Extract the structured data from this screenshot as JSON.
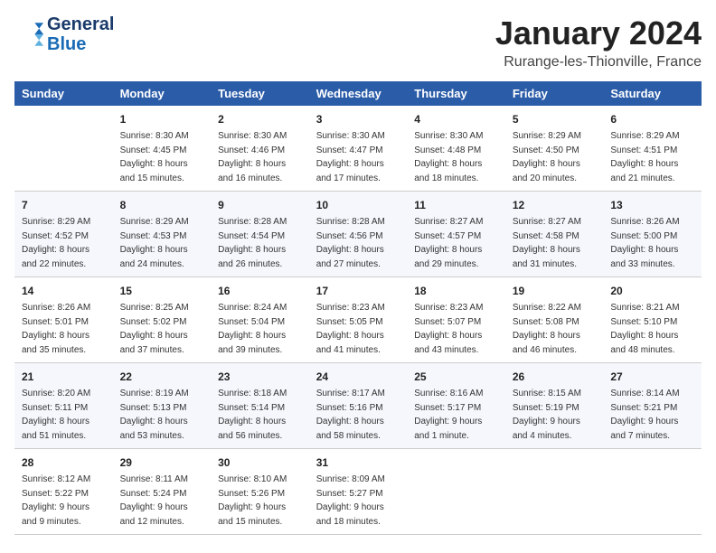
{
  "header": {
    "logo_line1": "General",
    "logo_line2": "Blue",
    "month_title": "January 2024",
    "location": "Rurange-les-Thionville, France"
  },
  "days_of_week": [
    "Sunday",
    "Monday",
    "Tuesday",
    "Wednesday",
    "Thursday",
    "Friday",
    "Saturday"
  ],
  "weeks": [
    [
      {
        "day": "",
        "sunrise": "",
        "sunset": "",
        "daylight": ""
      },
      {
        "day": "1",
        "sunrise": "Sunrise: 8:30 AM",
        "sunset": "Sunset: 4:45 PM",
        "daylight": "Daylight: 8 hours and 15 minutes."
      },
      {
        "day": "2",
        "sunrise": "Sunrise: 8:30 AM",
        "sunset": "Sunset: 4:46 PM",
        "daylight": "Daylight: 8 hours and 16 minutes."
      },
      {
        "day": "3",
        "sunrise": "Sunrise: 8:30 AM",
        "sunset": "Sunset: 4:47 PM",
        "daylight": "Daylight: 8 hours and 17 minutes."
      },
      {
        "day": "4",
        "sunrise": "Sunrise: 8:30 AM",
        "sunset": "Sunset: 4:48 PM",
        "daylight": "Daylight: 8 hours and 18 minutes."
      },
      {
        "day": "5",
        "sunrise": "Sunrise: 8:29 AM",
        "sunset": "Sunset: 4:50 PM",
        "daylight": "Daylight: 8 hours and 20 minutes."
      },
      {
        "day": "6",
        "sunrise": "Sunrise: 8:29 AM",
        "sunset": "Sunset: 4:51 PM",
        "daylight": "Daylight: 8 hours and 21 minutes."
      }
    ],
    [
      {
        "day": "7",
        "sunrise": "Sunrise: 8:29 AM",
        "sunset": "Sunset: 4:52 PM",
        "daylight": "Daylight: 8 hours and 22 minutes."
      },
      {
        "day": "8",
        "sunrise": "Sunrise: 8:29 AM",
        "sunset": "Sunset: 4:53 PM",
        "daylight": "Daylight: 8 hours and 24 minutes."
      },
      {
        "day": "9",
        "sunrise": "Sunrise: 8:28 AM",
        "sunset": "Sunset: 4:54 PM",
        "daylight": "Daylight: 8 hours and 26 minutes."
      },
      {
        "day": "10",
        "sunrise": "Sunrise: 8:28 AM",
        "sunset": "Sunset: 4:56 PM",
        "daylight": "Daylight: 8 hours and 27 minutes."
      },
      {
        "day": "11",
        "sunrise": "Sunrise: 8:27 AM",
        "sunset": "Sunset: 4:57 PM",
        "daylight": "Daylight: 8 hours and 29 minutes."
      },
      {
        "day": "12",
        "sunrise": "Sunrise: 8:27 AM",
        "sunset": "Sunset: 4:58 PM",
        "daylight": "Daylight: 8 hours and 31 minutes."
      },
      {
        "day": "13",
        "sunrise": "Sunrise: 8:26 AM",
        "sunset": "Sunset: 5:00 PM",
        "daylight": "Daylight: 8 hours and 33 minutes."
      }
    ],
    [
      {
        "day": "14",
        "sunrise": "Sunrise: 8:26 AM",
        "sunset": "Sunset: 5:01 PM",
        "daylight": "Daylight: 8 hours and 35 minutes."
      },
      {
        "day": "15",
        "sunrise": "Sunrise: 8:25 AM",
        "sunset": "Sunset: 5:02 PM",
        "daylight": "Daylight: 8 hours and 37 minutes."
      },
      {
        "day": "16",
        "sunrise": "Sunrise: 8:24 AM",
        "sunset": "Sunset: 5:04 PM",
        "daylight": "Daylight: 8 hours and 39 minutes."
      },
      {
        "day": "17",
        "sunrise": "Sunrise: 8:23 AM",
        "sunset": "Sunset: 5:05 PM",
        "daylight": "Daylight: 8 hours and 41 minutes."
      },
      {
        "day": "18",
        "sunrise": "Sunrise: 8:23 AM",
        "sunset": "Sunset: 5:07 PM",
        "daylight": "Daylight: 8 hours and 43 minutes."
      },
      {
        "day": "19",
        "sunrise": "Sunrise: 8:22 AM",
        "sunset": "Sunset: 5:08 PM",
        "daylight": "Daylight: 8 hours and 46 minutes."
      },
      {
        "day": "20",
        "sunrise": "Sunrise: 8:21 AM",
        "sunset": "Sunset: 5:10 PM",
        "daylight": "Daylight: 8 hours and 48 minutes."
      }
    ],
    [
      {
        "day": "21",
        "sunrise": "Sunrise: 8:20 AM",
        "sunset": "Sunset: 5:11 PM",
        "daylight": "Daylight: 8 hours and 51 minutes."
      },
      {
        "day": "22",
        "sunrise": "Sunrise: 8:19 AM",
        "sunset": "Sunset: 5:13 PM",
        "daylight": "Daylight: 8 hours and 53 minutes."
      },
      {
        "day": "23",
        "sunrise": "Sunrise: 8:18 AM",
        "sunset": "Sunset: 5:14 PM",
        "daylight": "Daylight: 8 hours and 56 minutes."
      },
      {
        "day": "24",
        "sunrise": "Sunrise: 8:17 AM",
        "sunset": "Sunset: 5:16 PM",
        "daylight": "Daylight: 8 hours and 58 minutes."
      },
      {
        "day": "25",
        "sunrise": "Sunrise: 8:16 AM",
        "sunset": "Sunset: 5:17 PM",
        "daylight": "Daylight: 9 hours and 1 minute."
      },
      {
        "day": "26",
        "sunrise": "Sunrise: 8:15 AM",
        "sunset": "Sunset: 5:19 PM",
        "daylight": "Daylight: 9 hours and 4 minutes."
      },
      {
        "day": "27",
        "sunrise": "Sunrise: 8:14 AM",
        "sunset": "Sunset: 5:21 PM",
        "daylight": "Daylight: 9 hours and 7 minutes."
      }
    ],
    [
      {
        "day": "28",
        "sunrise": "Sunrise: 8:12 AM",
        "sunset": "Sunset: 5:22 PM",
        "daylight": "Daylight: 9 hours and 9 minutes."
      },
      {
        "day": "29",
        "sunrise": "Sunrise: 8:11 AM",
        "sunset": "Sunset: 5:24 PM",
        "daylight": "Daylight: 9 hours and 12 minutes."
      },
      {
        "day": "30",
        "sunrise": "Sunrise: 8:10 AM",
        "sunset": "Sunset: 5:26 PM",
        "daylight": "Daylight: 9 hours and 15 minutes."
      },
      {
        "day": "31",
        "sunrise": "Sunrise: 8:09 AM",
        "sunset": "Sunset: 5:27 PM",
        "daylight": "Daylight: 9 hours and 18 minutes."
      },
      {
        "day": "",
        "sunrise": "",
        "sunset": "",
        "daylight": ""
      },
      {
        "day": "",
        "sunrise": "",
        "sunset": "",
        "daylight": ""
      },
      {
        "day": "",
        "sunrise": "",
        "sunset": "",
        "daylight": ""
      }
    ]
  ]
}
